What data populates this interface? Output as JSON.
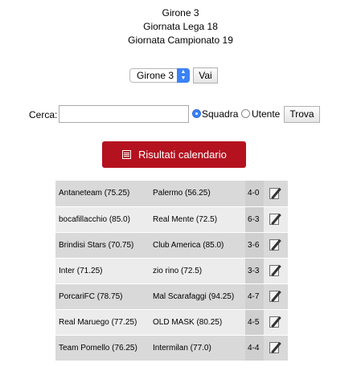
{
  "header": {
    "line1": "Girone 3",
    "line2": "Giornata Lega 18",
    "line3": "Giornata Campionato 19"
  },
  "selector": {
    "selected": "Girone 3",
    "go_label": "Vai"
  },
  "search": {
    "label": "Cerca:",
    "value": "",
    "options": [
      {
        "label": "Squadra",
        "checked": true
      },
      {
        "label": "Utente",
        "checked": false
      }
    ],
    "button_label": "Trova"
  },
  "calendar_button": {
    "label": "Risultati calendario",
    "icon": "list-icon"
  },
  "accent_color": "#b4121f",
  "matches": [
    {
      "home": "Antaneteam (75.25)",
      "away": "Palermo (56.25)",
      "score": "4-0"
    },
    {
      "home": "bocafillacchio (85.0)",
      "away": "Real Mente (72.5)",
      "score": "6-3"
    },
    {
      "home": "Brindisi Stars (70.75)",
      "away": "Club America (85.0)",
      "score": "3-6"
    },
    {
      "home": "Inter (71.25)",
      "away": "zio rino (72.5)",
      "score": "3-3"
    },
    {
      "home": "PorcariFC (78.75)",
      "away": "Mal Scarafaggi (94.25)",
      "score": "4-7"
    },
    {
      "home": "Real Maruego (77.25)",
      "away": "OLD MASK (80.25)",
      "score": "4-5"
    },
    {
      "home": "Team Pomello (76.25)",
      "away": "Intermilan (77.0)",
      "score": "4-4"
    }
  ]
}
